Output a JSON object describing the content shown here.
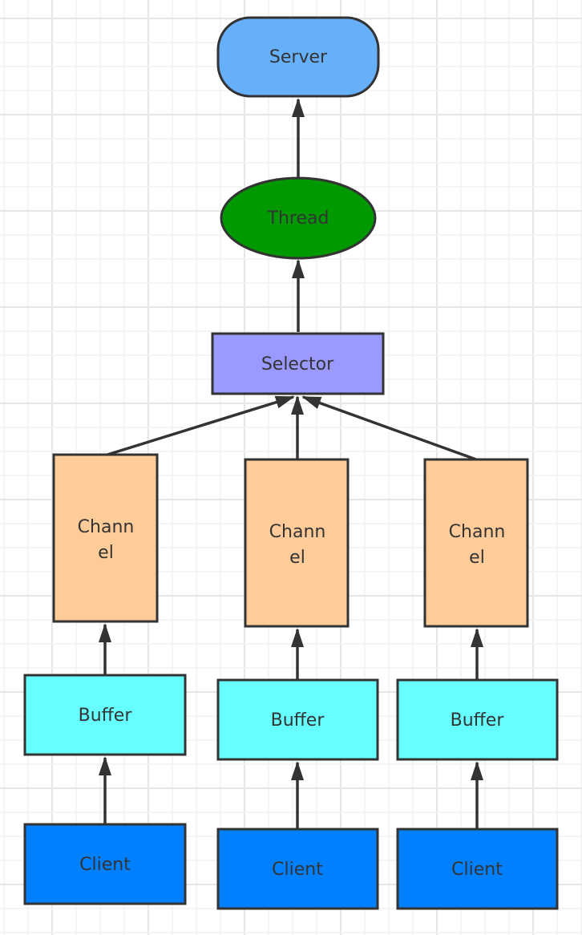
{
  "colors": {
    "server": "#66b0fa",
    "thread": "#009900",
    "selector": "#9999ff",
    "channel": "#ffcc99",
    "buffer": "#66ffff",
    "client": "#0080ff",
    "stroke": "#333333",
    "grid_minor": "#f2f2f2",
    "grid_major": "#e6e6e6"
  },
  "nodes": {
    "server": "Server",
    "thread": "Thread",
    "selector": "Selector",
    "channels": [
      {
        "line1": "Chann",
        "line2": "el"
      },
      {
        "line1": "Chann",
        "line2": "el"
      },
      {
        "line1": "Chann",
        "line2": "el"
      }
    ],
    "buffers": [
      "Buffer",
      "Buffer",
      "Buffer"
    ],
    "clients": [
      "Client",
      "Client",
      "Client"
    ]
  }
}
